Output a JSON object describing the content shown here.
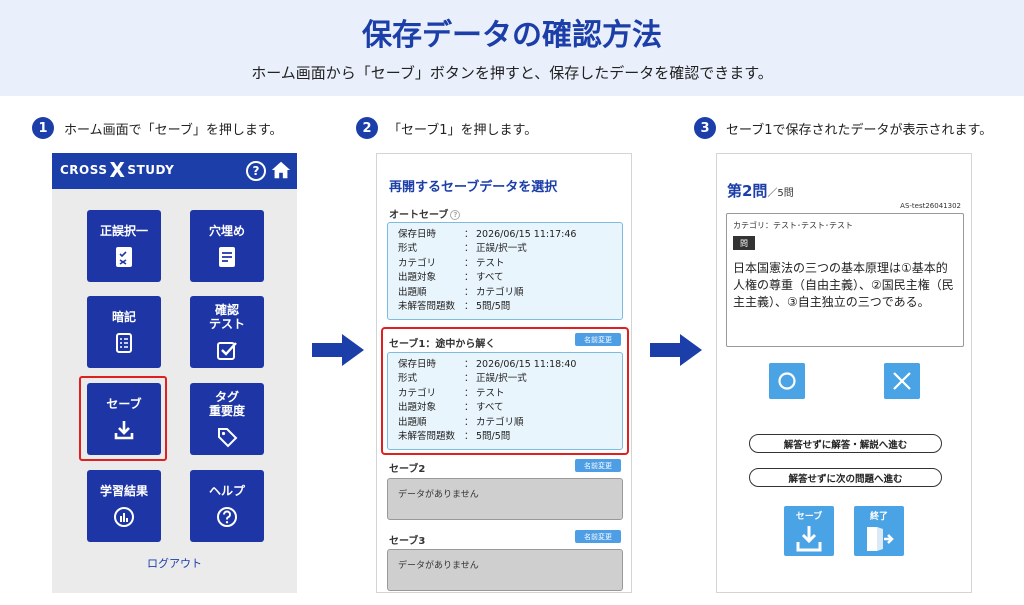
{
  "header": {
    "title": "保存データの確認方法",
    "subtitle": "ホーム画面から「セーブ」ボタンを押すと、保存したデータを確認できます。"
  },
  "steps": [
    {
      "num": "1",
      "text": "ホーム画面で「セーブ」を押します。"
    },
    {
      "num": "2",
      "text": "「セーブ1」を押します。"
    },
    {
      "num": "3",
      "text": "セーブ1で保存されたデータが表示されます。"
    }
  ],
  "colors": {
    "brand": "#1b3ea8",
    "tile": "#1e35a6",
    "accent": "#4aa3e4",
    "highlight": "#e02020"
  },
  "phone1": {
    "logo_left": "CROSS",
    "logo_x": "X",
    "logo_right": "STUDY",
    "help_icon": "?",
    "tiles": [
      {
        "label": "正誤択一",
        "icon": "checklist-icon"
      },
      {
        "label": "穴埋め",
        "icon": "document-icon"
      },
      {
        "label": "暗記",
        "icon": "list-icon"
      },
      {
        "label": "確認\nテスト",
        "icon": "checkbox-icon"
      },
      {
        "label": "セーブ",
        "icon": "download-icon"
      },
      {
        "label": "タグ\n重要度",
        "icon": "tag-icon"
      },
      {
        "label": "学習結果",
        "icon": "chart-icon"
      },
      {
        "label": "ヘルプ",
        "icon": "help-icon"
      }
    ],
    "logout": "ログアウト"
  },
  "phone2": {
    "title": "再開するセーブデータを選択",
    "auto_label": "オートセーブ",
    "rename": "名前変更",
    "auto_rows": [
      {
        "k": "保存日時",
        "v": "2026/06/15 11:17:46"
      },
      {
        "k": "形式",
        "v": "正誤/択一式"
      },
      {
        "k": "カテゴリ",
        "v": "テスト"
      },
      {
        "k": "出題対象",
        "v": "すべて"
      },
      {
        "k": "出題順",
        "v": "カテゴリ順"
      },
      {
        "k": "未解答問題数",
        "v": "5問/5問"
      }
    ],
    "save1_label": "セーブ1：途中から解く",
    "save1_rows": [
      {
        "k": "保存日時",
        "v": "2026/06/15 11:18:40"
      },
      {
        "k": "形式",
        "v": "正誤/択一式"
      },
      {
        "k": "カテゴリ",
        "v": "テスト"
      },
      {
        "k": "出題対象",
        "v": "すべて"
      },
      {
        "k": "出題順",
        "v": "カテゴリ順"
      },
      {
        "k": "未解答問題数",
        "v": "5問/5問"
      }
    ],
    "colon": "：",
    "save2_label": "セーブ2",
    "save3_label": "セーブ3",
    "empty": "データがありません"
  },
  "phone3": {
    "qnum": "第2問",
    "total": "／5問",
    "id": "AS-test26041302",
    "category": "カテゴリ：テスト･テスト･テスト",
    "badge": "問",
    "question": "日本国憲法の三つの基本原理は①基本的人権の尊重（自由主義）、②国民主権（民主主義）、③自主独立の三つである。",
    "btn_show_answer": "解答せずに解答・解説へ進む",
    "btn_next": "解答せずに次の問題へ進む",
    "save_label": "セーブ",
    "end_label": "終了"
  }
}
